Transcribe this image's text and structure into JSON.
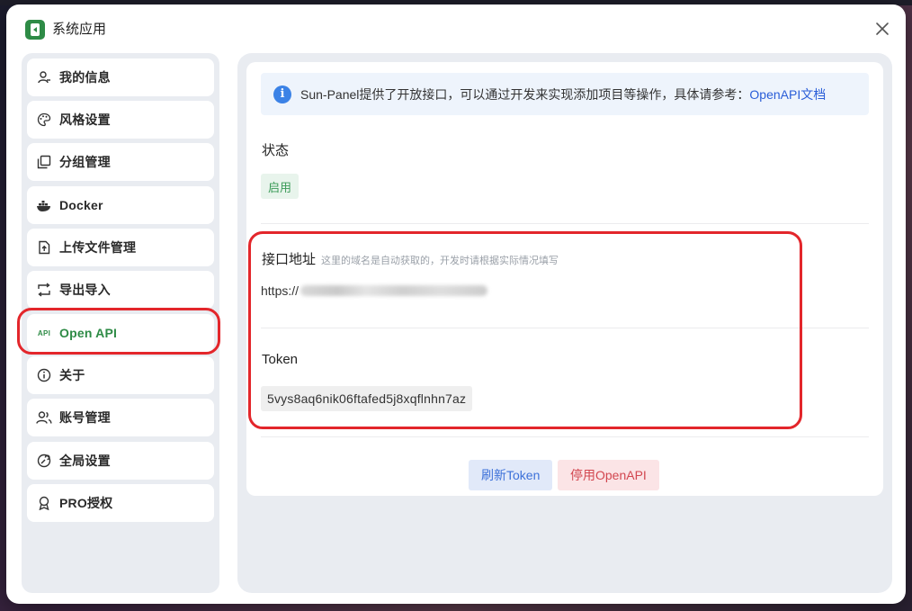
{
  "window": {
    "title": "系统应用",
    "close_label": "×"
  },
  "sidebar": {
    "items": [
      {
        "label": "我的信息",
        "icon": "user-icon"
      },
      {
        "label": "风格设置",
        "icon": "palette-icon"
      },
      {
        "label": "分组管理",
        "icon": "copy-icon"
      },
      {
        "label": "Docker",
        "icon": "docker-icon"
      },
      {
        "label": "上传文件管理",
        "icon": "file-upload-icon"
      },
      {
        "label": "导出导入",
        "icon": "import-export-icon"
      },
      {
        "label": "Open API",
        "icon": "api-icon",
        "icon_text": "API",
        "active": true
      },
      {
        "label": "关于",
        "icon": "info-icon"
      },
      {
        "label": "账号管理",
        "icon": "users-icon"
      },
      {
        "label": "全局设置",
        "icon": "settings-icon"
      },
      {
        "label": "PRO授权",
        "icon": "award-icon"
      }
    ]
  },
  "main": {
    "alert": {
      "icon_text": "i",
      "text": "Sun-Panel提供了开放接口，可以通过开发来实现添加项目等操作，具体请参考：",
      "link_text": "OpenAPI文档"
    },
    "status": {
      "title": "状态",
      "value": "启用"
    },
    "endpoint": {
      "title": "接口地址",
      "hint": "这里的域名是自动获取的，开发时请根据实际情况填写",
      "url_prefix": "https://"
    },
    "token": {
      "title": "Token",
      "value": "5vys8aq6nik06ftafed5j8xqflnhn7az"
    },
    "buttons": {
      "refresh": "刷新Token",
      "disable": "停用OpenAPI"
    }
  },
  "colors": {
    "accent_green": "#2e8b46",
    "highlight_red": "#e3262b",
    "link_blue": "#2a5ed8"
  }
}
